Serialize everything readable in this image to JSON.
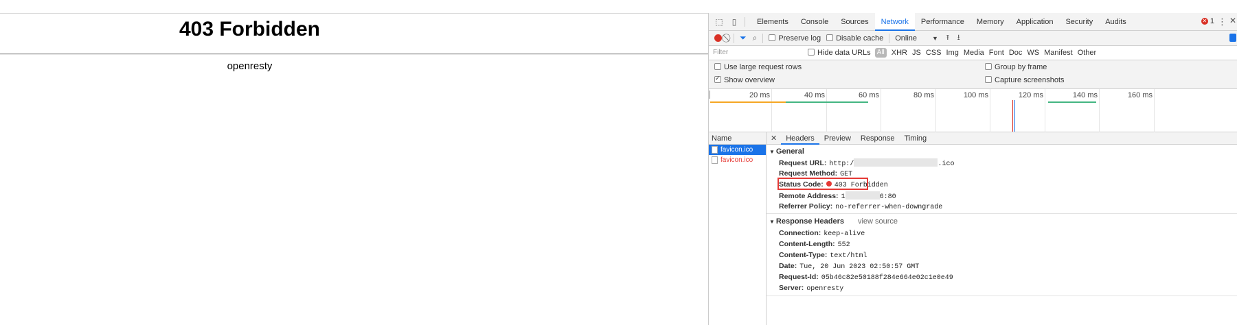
{
  "page": {
    "title": "403 Forbidden",
    "server": "openresty"
  },
  "devtools": {
    "tabs": [
      "Elements",
      "Console",
      "Sources",
      "Network",
      "Performance",
      "Memory",
      "Application",
      "Security",
      "Audits"
    ],
    "active_tab": "Network",
    "error_count": "1",
    "toolbar": {
      "preserve_log": "Preserve log",
      "disable_cache": "Disable cache",
      "throttle": "Online"
    },
    "filter": {
      "placeholder": "Filter",
      "hide_data_urls": "Hide data URLs",
      "types": [
        "All",
        "XHR",
        "JS",
        "CSS",
        "Img",
        "Media",
        "Font",
        "Doc",
        "WS",
        "Manifest",
        "Other"
      ]
    },
    "options": {
      "large_rows": "Use large request rows",
      "group_by_frame": "Group by frame",
      "show_overview": "Show overview",
      "capture_screenshots": "Capture screenshots"
    },
    "overview_ticks": [
      "20 ms",
      "40 ms",
      "60 ms",
      "80 ms",
      "100 ms",
      "120 ms",
      "140 ms",
      "160 ms"
    ],
    "requests": {
      "header": "Name",
      "items": [
        "favicon.ico",
        "favicon.ico"
      ]
    },
    "detail_tabs": [
      "Headers",
      "Preview",
      "Response",
      "Timing"
    ],
    "general": {
      "title": "General",
      "request_url_label": "Request URL:",
      "request_url_prefix": "http:/",
      "request_url_suffix": ".ico",
      "request_method_label": "Request Method:",
      "request_method": "GET",
      "status_code_label": "Status Code:",
      "status_code": "403 Forbidden",
      "remote_address_label": "Remote Address:",
      "remote_address_prefix": "1",
      "remote_address_suffix": "6:80",
      "referrer_policy_label": "Referrer Policy:",
      "referrer_policy": "no-referrer-when-downgrade"
    },
    "response_headers": {
      "title": "Response Headers",
      "view_source": "view source",
      "items": [
        {
          "k": "Connection:",
          "v": "keep-alive"
        },
        {
          "k": "Content-Length:",
          "v": "552"
        },
        {
          "k": "Content-Type:",
          "v": "text/html"
        },
        {
          "k": "Date:",
          "v": "Tue, 20 Jun 2023 02:50:57 GMT"
        },
        {
          "k": "Request-Id:",
          "v": "05b46c82e50188f284e664e02c1e0e49"
        },
        {
          "k": "Server:",
          "v": "openresty"
        }
      ]
    }
  }
}
